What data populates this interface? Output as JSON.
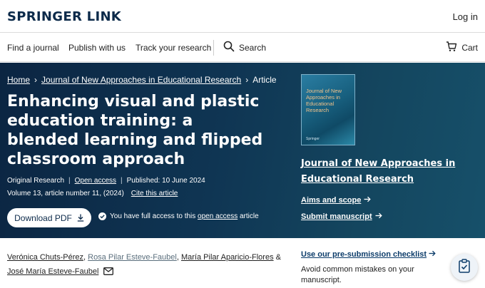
{
  "header": {
    "logo": "SPRINGER LINK",
    "login_label": "Log in"
  },
  "nav": {
    "items": [
      "Find a journal",
      "Publish with us",
      "Track your research"
    ],
    "search_label": "Search",
    "cart_label": "Cart"
  },
  "breadcrumb": {
    "home": "Home",
    "journal": "Journal of New Approaches in Educational Research",
    "current": "Article"
  },
  "article": {
    "title": "Enhancing visual and plastic education training: a blended learning and flipped classroom approach",
    "type": "Original Research",
    "open_access": "Open access",
    "published": "Published: 10 June 2024",
    "volume": "Volume 13, article number 11, (2024)",
    "cite_label": "Cite this article",
    "download_label": "Download PDF",
    "access_prefix": "You have full access to this ",
    "access_link": "open access",
    "access_suffix": " article"
  },
  "journal": {
    "cover_title": "Journal of New Approaches in Educational Research",
    "cover_publisher": "Springer",
    "name": "Journal of New Approaches in Educational Research",
    "aims_label": "Aims and scope",
    "submit_label": "Submit manuscript"
  },
  "authors": {
    "a1": "Verónica Chuts-Pérez",
    "a2": "Rosa Pilar Esteve-Faubel",
    "a3": "María Pilar Aparicio-Flores",
    "a4": "José María Esteve-Faubel",
    "sep": ",",
    "amp": "&"
  },
  "side": {
    "checklist_label": "Use our pre-submission checklist",
    "checklist_desc": "Avoid common mistakes on your manuscript."
  },
  "colors": {
    "brand_navy": "#0c2a4a",
    "hero_dark": "#0b2542",
    "hero_teal": "#16506a",
    "link_blue": "#0c3c6a"
  },
  "icons": {
    "search": "search-icon",
    "cart": "cart-icon",
    "download": "download-icon",
    "access": "check-circle-icon",
    "mail": "mail-icon",
    "checklist": "clipboard-check-icon"
  }
}
